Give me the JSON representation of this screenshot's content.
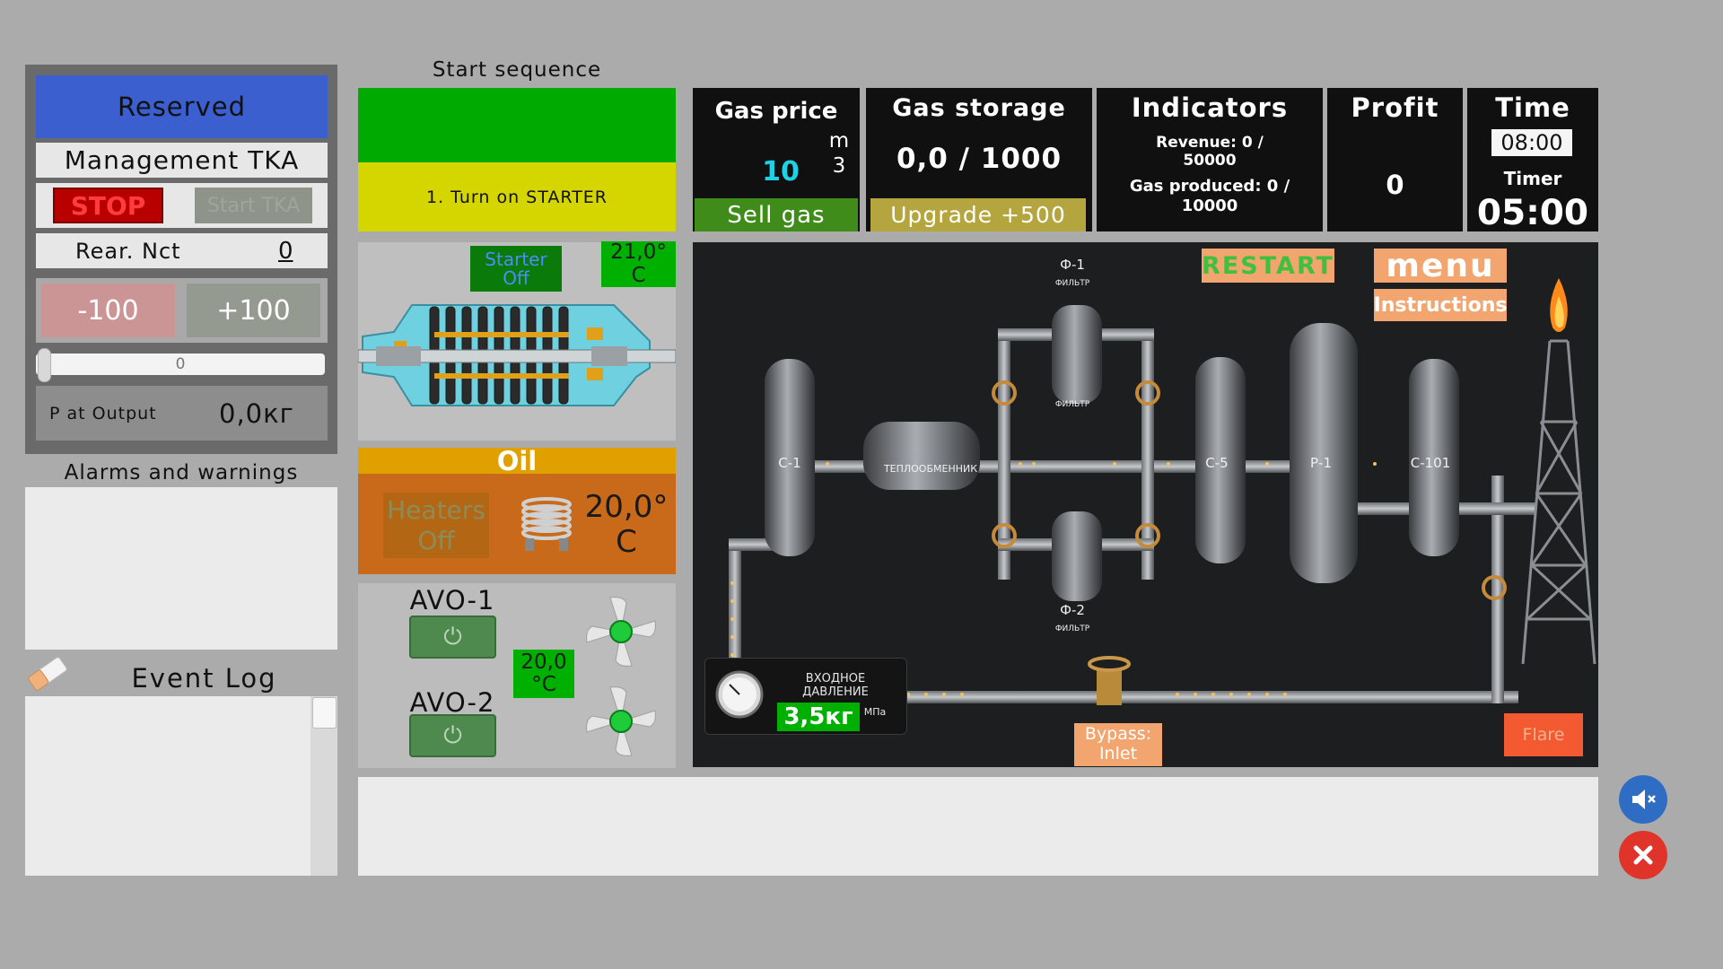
{
  "control": {
    "reserved": "Reserved",
    "management": "Management TKA",
    "stop": "STOP",
    "start_tka": "Start TKA",
    "rear_label": "Rear. Nct",
    "rear_value": "0",
    "minus": "-100",
    "plus": "+100",
    "slider_value": "0",
    "p_output_label": "P at Output",
    "p_output_value": "0,0кг"
  },
  "alarms": {
    "title": "Alarms and warnings"
  },
  "event_log": {
    "title": "Event Log"
  },
  "sequence": {
    "title": "Start sequence",
    "step": "1. Turn on STARTER"
  },
  "compressor": {
    "starter_status": "Starter Off",
    "temperature": "21,0° C"
  },
  "oil": {
    "title": "Oil",
    "heaters": "Heaters Off",
    "temperature": "20,0° C"
  },
  "avo": {
    "avo1": "AVO-1",
    "avo2": "AVO-2",
    "temperature": "20,0 °C",
    "power_icon": "⏻"
  },
  "gas_price": {
    "title": "Gas price",
    "unit_m": "m",
    "unit_3": "3",
    "value": "10",
    "button": "Sell gas"
  },
  "gas_storage": {
    "title": "Gas storage",
    "value": "0,0 / 1000",
    "button": "Upgrade +500"
  },
  "indicators": {
    "title": "Indicators",
    "revenue": "Revenue: 0 / 50000",
    "gas_produced": "Gas produced: 0 / 10000"
  },
  "profit": {
    "title": "Profit",
    "value": "0"
  },
  "time": {
    "title": "Time",
    "clock": "08:00",
    "timer_label": "Timer",
    "timer": "05:00"
  },
  "process": {
    "restart": "RESTART",
    "menu": "menu",
    "instructions": "Instructions",
    "gauge_title": "ВХОДНОЕ ДАВЛЕНИЕ",
    "gauge_value": "3,5кг",
    "gauge_unit": "МПа",
    "bypass": "Bypass: Inlet",
    "flare": "Flare",
    "labels": {
      "c1": "С-1",
      "heat": "ТЕПЛООБМЕННИК",
      "f1": "Ф-1",
      "f1sub": "ФИЛЬТР",
      "f1sub2": "ФИЛЬТР",
      "f2": "Ф-2",
      "f2sub": "ФИЛЬТР",
      "c5": "С-5",
      "p1": "Р-1",
      "c101": "С-101"
    }
  },
  "colors": {
    "reserved": "#3c5fd0",
    "stop_text": "#ff3b3b",
    "ok_green": "#00b000",
    "accent_orange": "#f2a56e",
    "timer_value": "#1fd0e6"
  },
  "icons": {
    "sound": "speaker-muted-icon",
    "close": "close-icon",
    "eraser": "eraser-icon"
  }
}
